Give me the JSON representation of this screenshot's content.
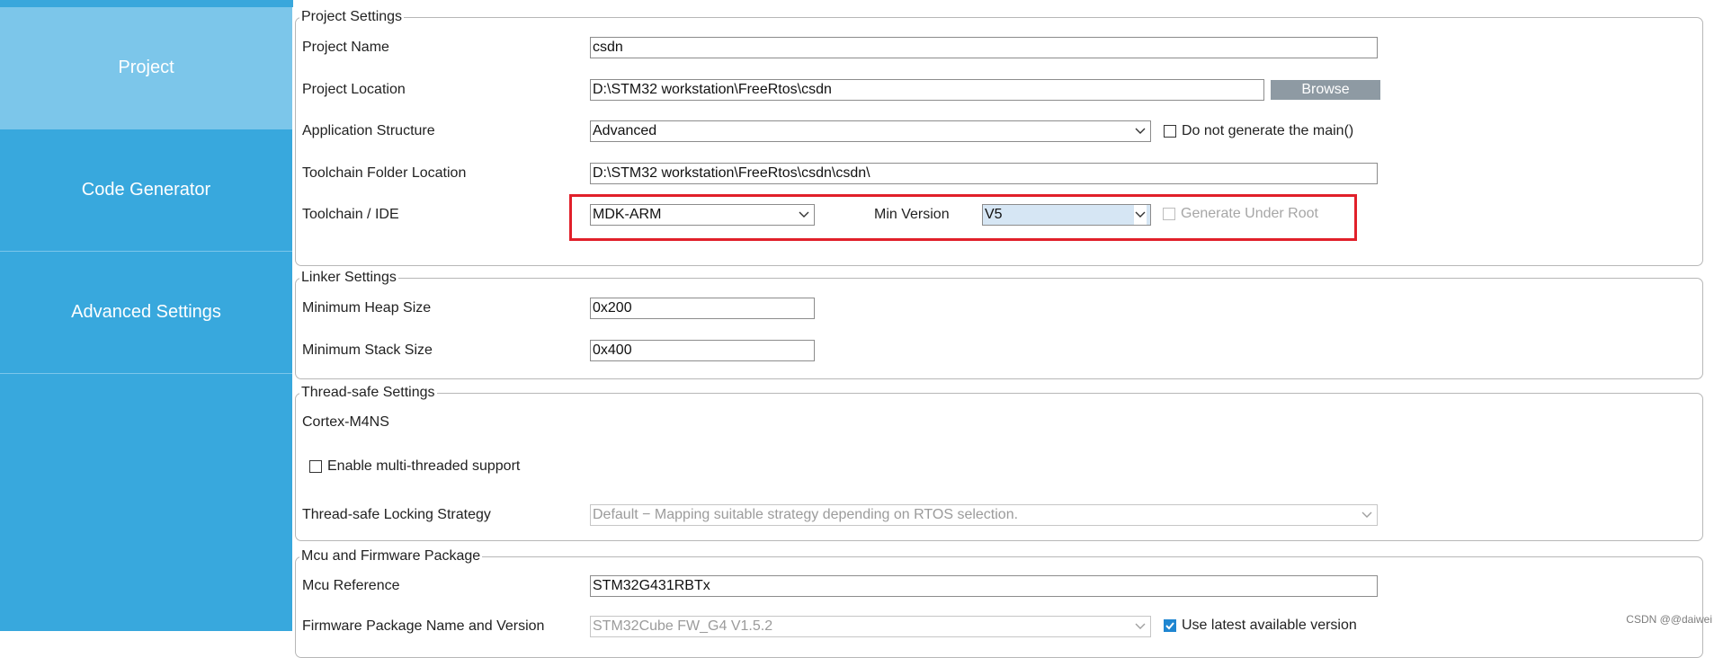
{
  "sidebar": {
    "items": [
      {
        "label": "Project",
        "active": true
      },
      {
        "label": "Code Generator",
        "active": false
      },
      {
        "label": "Advanced Settings",
        "active": false
      }
    ]
  },
  "project_settings": {
    "legend": "Project Settings",
    "project_name": {
      "label": "Project Name",
      "value": "csdn"
    },
    "project_location": {
      "label": "Project Location",
      "value": "D:\\STM32 workstation\\FreeRtos\\csdn",
      "browse_label": "Browse"
    },
    "application_structure": {
      "label": "Application Structure",
      "value": "Advanced",
      "checkbox_label": "Do not generate the main()",
      "checked": false
    },
    "toolchain_folder": {
      "label": "Toolchain Folder Location",
      "value": "D:\\STM32 workstation\\FreeRtos\\csdn\\csdn\\"
    },
    "toolchain_ide": {
      "label": "Toolchain / IDE",
      "value": "MDK-ARM",
      "min_version_label": "Min Version",
      "min_version_value": "V5",
      "generate_under_root_label": "Generate Under Root",
      "generate_under_root_checked": false
    }
  },
  "linker_settings": {
    "legend": "Linker Settings",
    "heap": {
      "label": "Minimum Heap Size",
      "value": "0x200"
    },
    "stack": {
      "label": "Minimum Stack Size",
      "value": "0x400"
    }
  },
  "thread_safe_settings": {
    "legend": "Thread-safe Settings",
    "core": "Cortex-M4NS",
    "multithread_label": "Enable multi-threaded support",
    "multithread_checked": false,
    "locking_label": "Thread-safe Locking Strategy",
    "locking_value": "Default  −  Mapping suitable strategy depending on RTOS selection."
  },
  "mcu_firmware": {
    "legend": "Mcu and Firmware Package",
    "mcu_reference_label": "Mcu Reference",
    "mcu_reference_value": "STM32G431RBTx",
    "fw_label": "Firmware Package Name and Version",
    "fw_value": "STM32Cube FW_G4 V1.5.2",
    "use_latest_label": "Use latest available version",
    "use_latest_checked": true
  },
  "watermark": "CSDN @@daiwei",
  "colors": {
    "sidebar": "#38a8dd",
    "sidebar_active": "#7cc6ea",
    "highlight": "#e1202a",
    "browse_button": "#8e9aa3"
  }
}
